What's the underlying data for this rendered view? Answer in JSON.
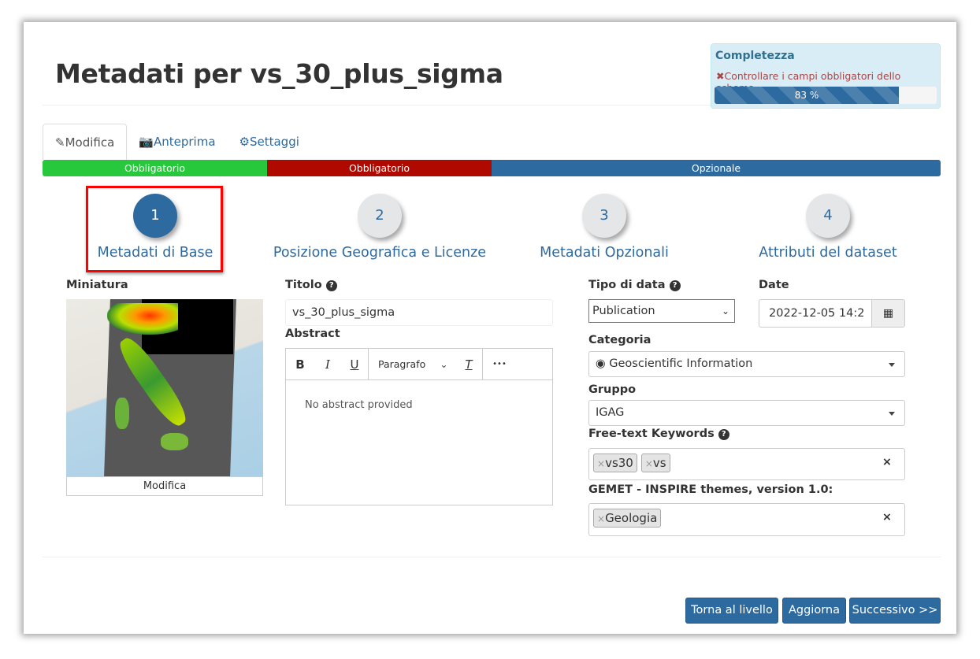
{
  "page_title": "Metadati per vs_30_plus_sigma",
  "completeness": {
    "title": "Completezza",
    "warning": "Controllare i campi obbligatori dello schema",
    "percent": 83,
    "percent_label": "83 %"
  },
  "tabs": [
    {
      "label": "Modifica",
      "icon": "pencil-icon"
    },
    {
      "label": "Anteprima",
      "icon": "camera-icon"
    },
    {
      "label": "Settaggi",
      "icon": "gear-icon"
    }
  ],
  "segments": [
    {
      "label": "Obbligatorio",
      "color": "#28c83c"
    },
    {
      "label": "Obbligatorio",
      "color": "#b00a00"
    },
    {
      "label": "Opzionale",
      "color": "#2d6a9f"
    }
  ],
  "steps": [
    {
      "num": "1",
      "label": "Metadati di Base"
    },
    {
      "num": "2",
      "label": "Posizione Geografica e Licenze"
    },
    {
      "num": "3",
      "label": "Metadati Opzionali"
    },
    {
      "num": "4",
      "label": "Attributi del dataset"
    }
  ],
  "thumbnail": {
    "label": "Miniatura",
    "button": "Modifica"
  },
  "title_field": {
    "label": "Titolo",
    "value": "vs_30_plus_sigma"
  },
  "abstract": {
    "label": "Abstract",
    "paragraph": "Paragrafo",
    "placeholder": "No abstract provided",
    "bold": "B",
    "italic": "I",
    "underline": "U",
    "clear": "T",
    "more": "•••"
  },
  "data_type": {
    "label": "Tipo di data",
    "value": "Publication"
  },
  "date": {
    "label": "Date",
    "value": "2022-12-05 14:2"
  },
  "category": {
    "label": "Categoria",
    "value": "Geoscientific Information"
  },
  "group": {
    "label": "Gruppo",
    "value": "IGAG"
  },
  "keywords": {
    "label": "Free-text Keywords",
    "tags": [
      "vs30",
      "vs"
    ]
  },
  "gemet": {
    "label": "GEMET - INSPIRE themes, version 1.0:",
    "tags": [
      "Geologia"
    ]
  },
  "buttons": {
    "back": "Torna al livello",
    "update": "Aggiorna",
    "next": "Successivo >>"
  }
}
